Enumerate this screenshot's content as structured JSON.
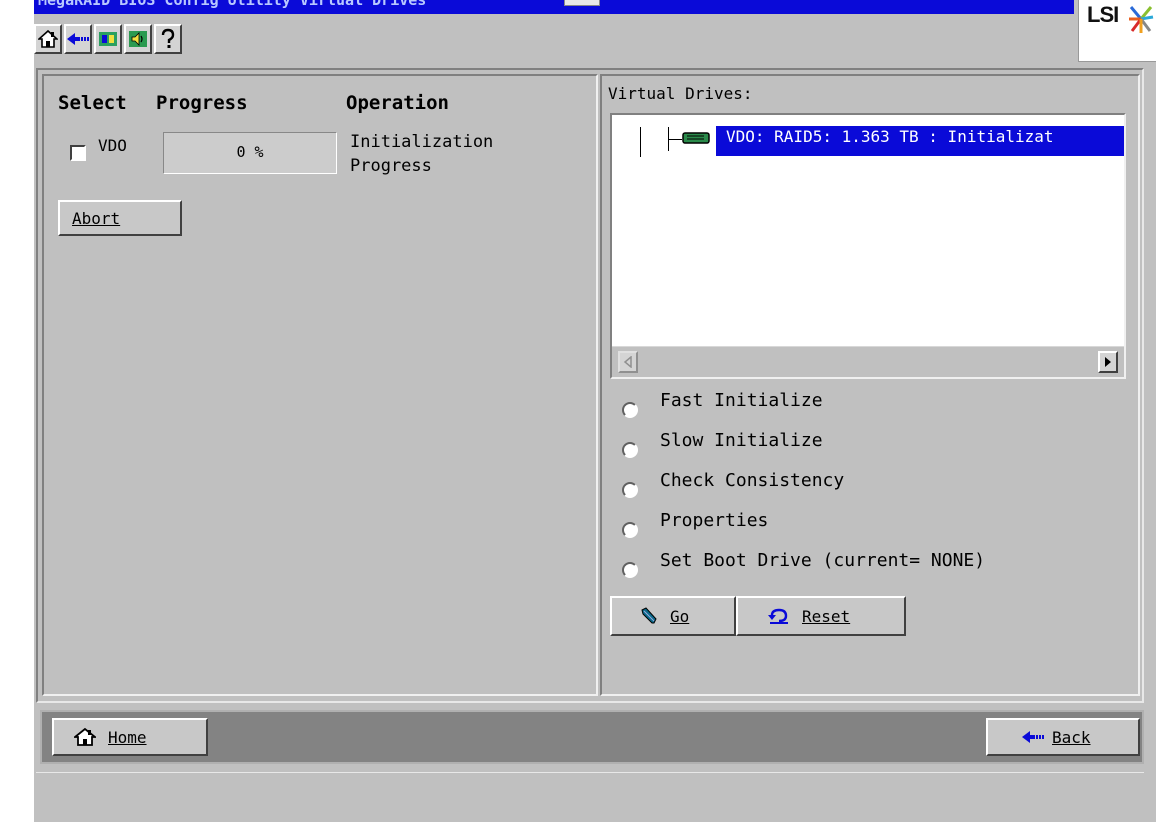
{
  "window": {
    "title": "MegaRAID BIOS Config Utility Virtual Drives"
  },
  "logo": {
    "text": "LSI"
  },
  "toolbar": {
    "icons": [
      "home-icon",
      "back-arrow-icon",
      "utility-icon",
      "speaker-icon",
      "help-icon"
    ]
  },
  "left": {
    "headers": {
      "select": "Select",
      "progress": "Progress",
      "operation": "Operation"
    },
    "rows": [
      {
        "drive": "VDO",
        "progress_text": "0 %",
        "progress_fraction": 0,
        "operation_line1": "Initialization",
        "operation_line2": "Progress"
      }
    ],
    "abort_label": "Abort"
  },
  "right": {
    "title": "Virtual Drives:",
    "tree_item": "VDO: RAID5: 1.363 TB : Initializat",
    "options": [
      {
        "label": "Fast Initialize"
      },
      {
        "label": "Slow Initialize"
      },
      {
        "label": "Check Consistency"
      },
      {
        "label": "Properties"
      },
      {
        "label": "Set Boot Drive (current= NONE)"
      }
    ],
    "go_label": "Go",
    "reset_label": "Reset"
  },
  "bottom": {
    "home_label": "Home",
    "back_label": "Back"
  },
  "colors": {
    "accent": "#0a0ad8",
    "face": "#c0c0c0"
  }
}
